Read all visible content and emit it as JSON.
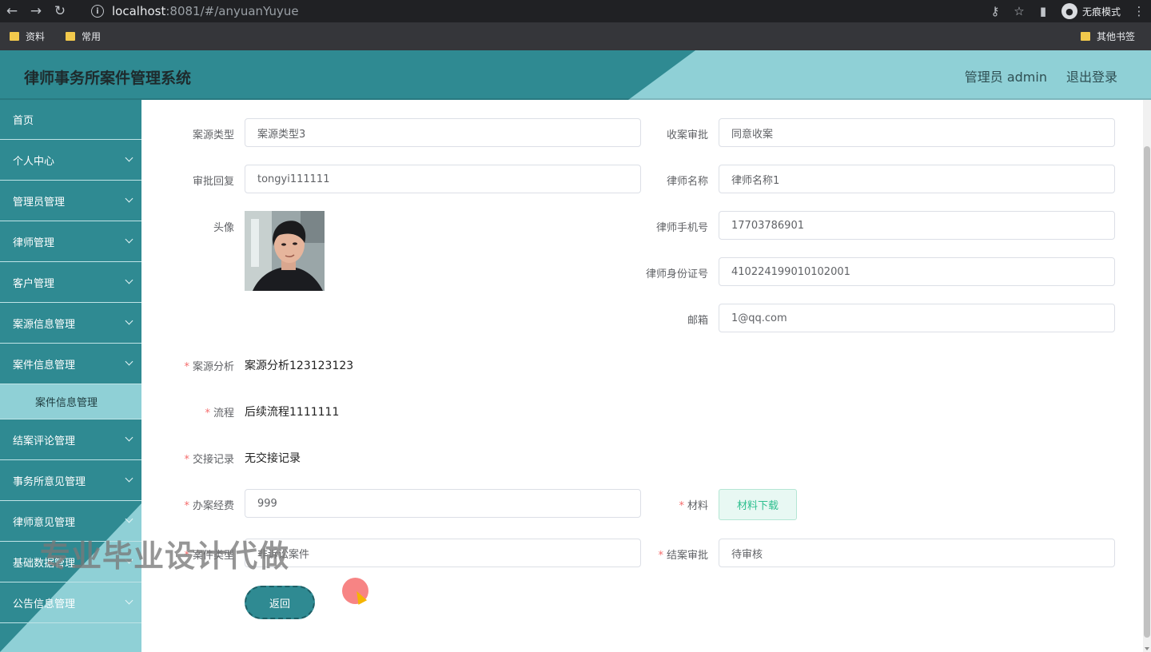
{
  "browser": {
    "url_host": "localhost",
    "url_rest": ":8081/#/anyuanYuyue",
    "incognito_label": "无痕模式",
    "bookmarks": [
      "资料",
      "常用"
    ],
    "bookmarks_right": "其他书签"
  },
  "header": {
    "title": "律师事务所案件管理系统",
    "user": "管理员 admin",
    "logout": "退出登录"
  },
  "sidebar": {
    "items": [
      {
        "label": "首页"
      },
      {
        "label": "个人中心"
      },
      {
        "label": "管理员管理"
      },
      {
        "label": "律师管理"
      },
      {
        "label": "客户管理"
      },
      {
        "label": "案源信息管理"
      },
      {
        "label": "案件信息管理"
      },
      {
        "label": "结案评论管理"
      },
      {
        "label": "事务所意见管理"
      },
      {
        "label": "律师意见管理"
      },
      {
        "label": "基础数据管理"
      },
      {
        "label": "公告信息管理"
      }
    ],
    "active_sub": "案件信息管理"
  },
  "form": {
    "case_source_type": {
      "label": "案源类型",
      "value": "案源类型3"
    },
    "accept_approval": {
      "label": "收案审批",
      "value": "同意收案"
    },
    "approval_reply": {
      "label": "审批回复",
      "value": "tongyi111111"
    },
    "lawyer_name": {
      "label": "律师名称",
      "value": "律师名称1"
    },
    "avatar": {
      "label": "头像"
    },
    "lawyer_phone": {
      "label": "律师手机号",
      "value": "17703786901"
    },
    "lawyer_id": {
      "label": "律师身份证号",
      "value": "410224199010102001"
    },
    "email": {
      "label": "邮箱",
      "value": "1@qq.com"
    },
    "analysis": {
      "label": "案源分析",
      "value": "案源分析123123123"
    },
    "process": {
      "label": "流程",
      "value": "后续流程1111111"
    },
    "handover": {
      "label": "交接记录",
      "value": "无交接记录"
    },
    "fee": {
      "label": "办案经费",
      "value": "999"
    },
    "material": {
      "label": "材料",
      "button": "材料下载"
    },
    "case_type": {
      "label": "案件类型",
      "value": "非诉讼案件"
    },
    "close_approval": {
      "label": "结案审批",
      "value": "待审核"
    },
    "back_button": "返回"
  },
  "watermark": "专业毕业设计代做",
  "colors": {
    "primary": "#2f8a92",
    "accent_light": "#8fd0d6",
    "required": "#f56c6c",
    "download_text": "#2fbf8f"
  }
}
